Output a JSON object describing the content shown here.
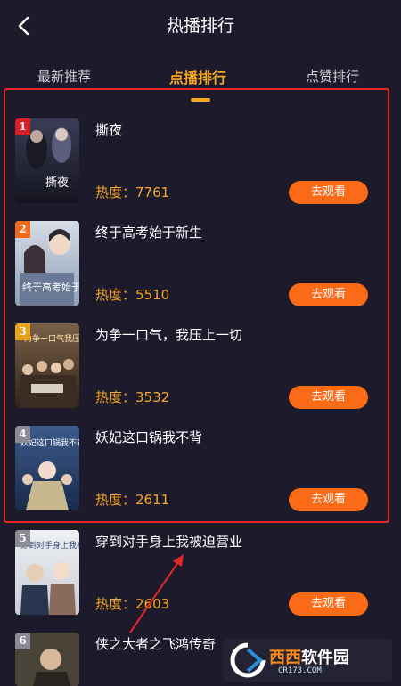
{
  "header": {
    "title": "热播排行"
  },
  "tabs": [
    {
      "label": "最新推荐",
      "active": false
    },
    {
      "label": "点播排行",
      "active": true
    },
    {
      "label": "点赞排行",
      "active": false
    }
  ],
  "accent_color": "#f5a623",
  "button_color": "#fa6a17",
  "highlight_color": "#e3262a",
  "items": [
    {
      "rank": "1",
      "title": "撕夜",
      "heat": "热度：7761",
      "button": "去观看",
      "rank_color": "#d91e26"
    },
    {
      "rank": "2",
      "title": "终于高考始于新生",
      "heat": "热度：5510",
      "button": "去观看",
      "rank_color": "#f26b1d"
    },
    {
      "rank": "3",
      "title": "为争一口气，我压上一切",
      "heat": "热度：3532",
      "button": "去观看",
      "rank_color": "#e8a317"
    },
    {
      "rank": "4",
      "title": "妖妃这口锅我不背",
      "heat": "热度：2611",
      "button": "去观看",
      "rank_color": "#8b8b96"
    },
    {
      "rank": "5",
      "title": "穿到对手身上我被迫营业",
      "heat": "热度：2603",
      "button": "去观看",
      "rank_color": "#8b8b96"
    },
    {
      "rank": "6",
      "title": "侠之大者之飞鸿传奇",
      "heat": "",
      "button": "",
      "rank_color": "#8b8b96"
    }
  ],
  "covers": [
    {
      "text": "撕夜"
    },
    {
      "text": "终于高考始于新生"
    },
    {
      "text": "为争一口气我压上一切"
    },
    {
      "text": "妖妃这口锅我不背"
    },
    {
      "text": "穿到对手身上我被迫营业"
    },
    {
      "text": ""
    }
  ],
  "watermark": {
    "brand_a": "西西",
    "brand_b": "软件园",
    "site": "CR173.COM"
  }
}
